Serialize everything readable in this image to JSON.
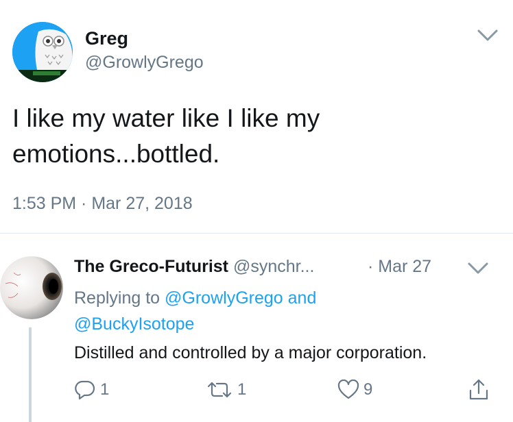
{
  "tweet": {
    "author_name": "Greg",
    "author_handle": "@GrowlyGrego",
    "text_line1": "I like my water like I like my",
    "text_line2": "emotions...bottled.",
    "timestamp": "1:53 PM · Mar 27, 2018",
    "avatar_icon": "owl-avatar",
    "menu_icon": "chevron-down-icon"
  },
  "reply": {
    "author_name": "The Greco-Futurist",
    "author_handle": "@synchr...",
    "date": "· Mar 27",
    "replying_prefix": "Replying to",
    "mention_1": "@GrowlyGrego",
    "mention_joiner": "and",
    "mention_2": "@BuckyIsotope",
    "text": "Distilled and controlled by a major corporation.",
    "avatar_icon": "eyeball-avatar",
    "menu_icon": "chevron-down-icon",
    "actions": {
      "reply_count": "1",
      "retweet_count": "1",
      "like_count": "9"
    }
  },
  "colors": {
    "text_primary": "#14171a",
    "text_secondary": "#657786",
    "link_blue": "#1da1f2",
    "divider": "#e1e8ed"
  }
}
